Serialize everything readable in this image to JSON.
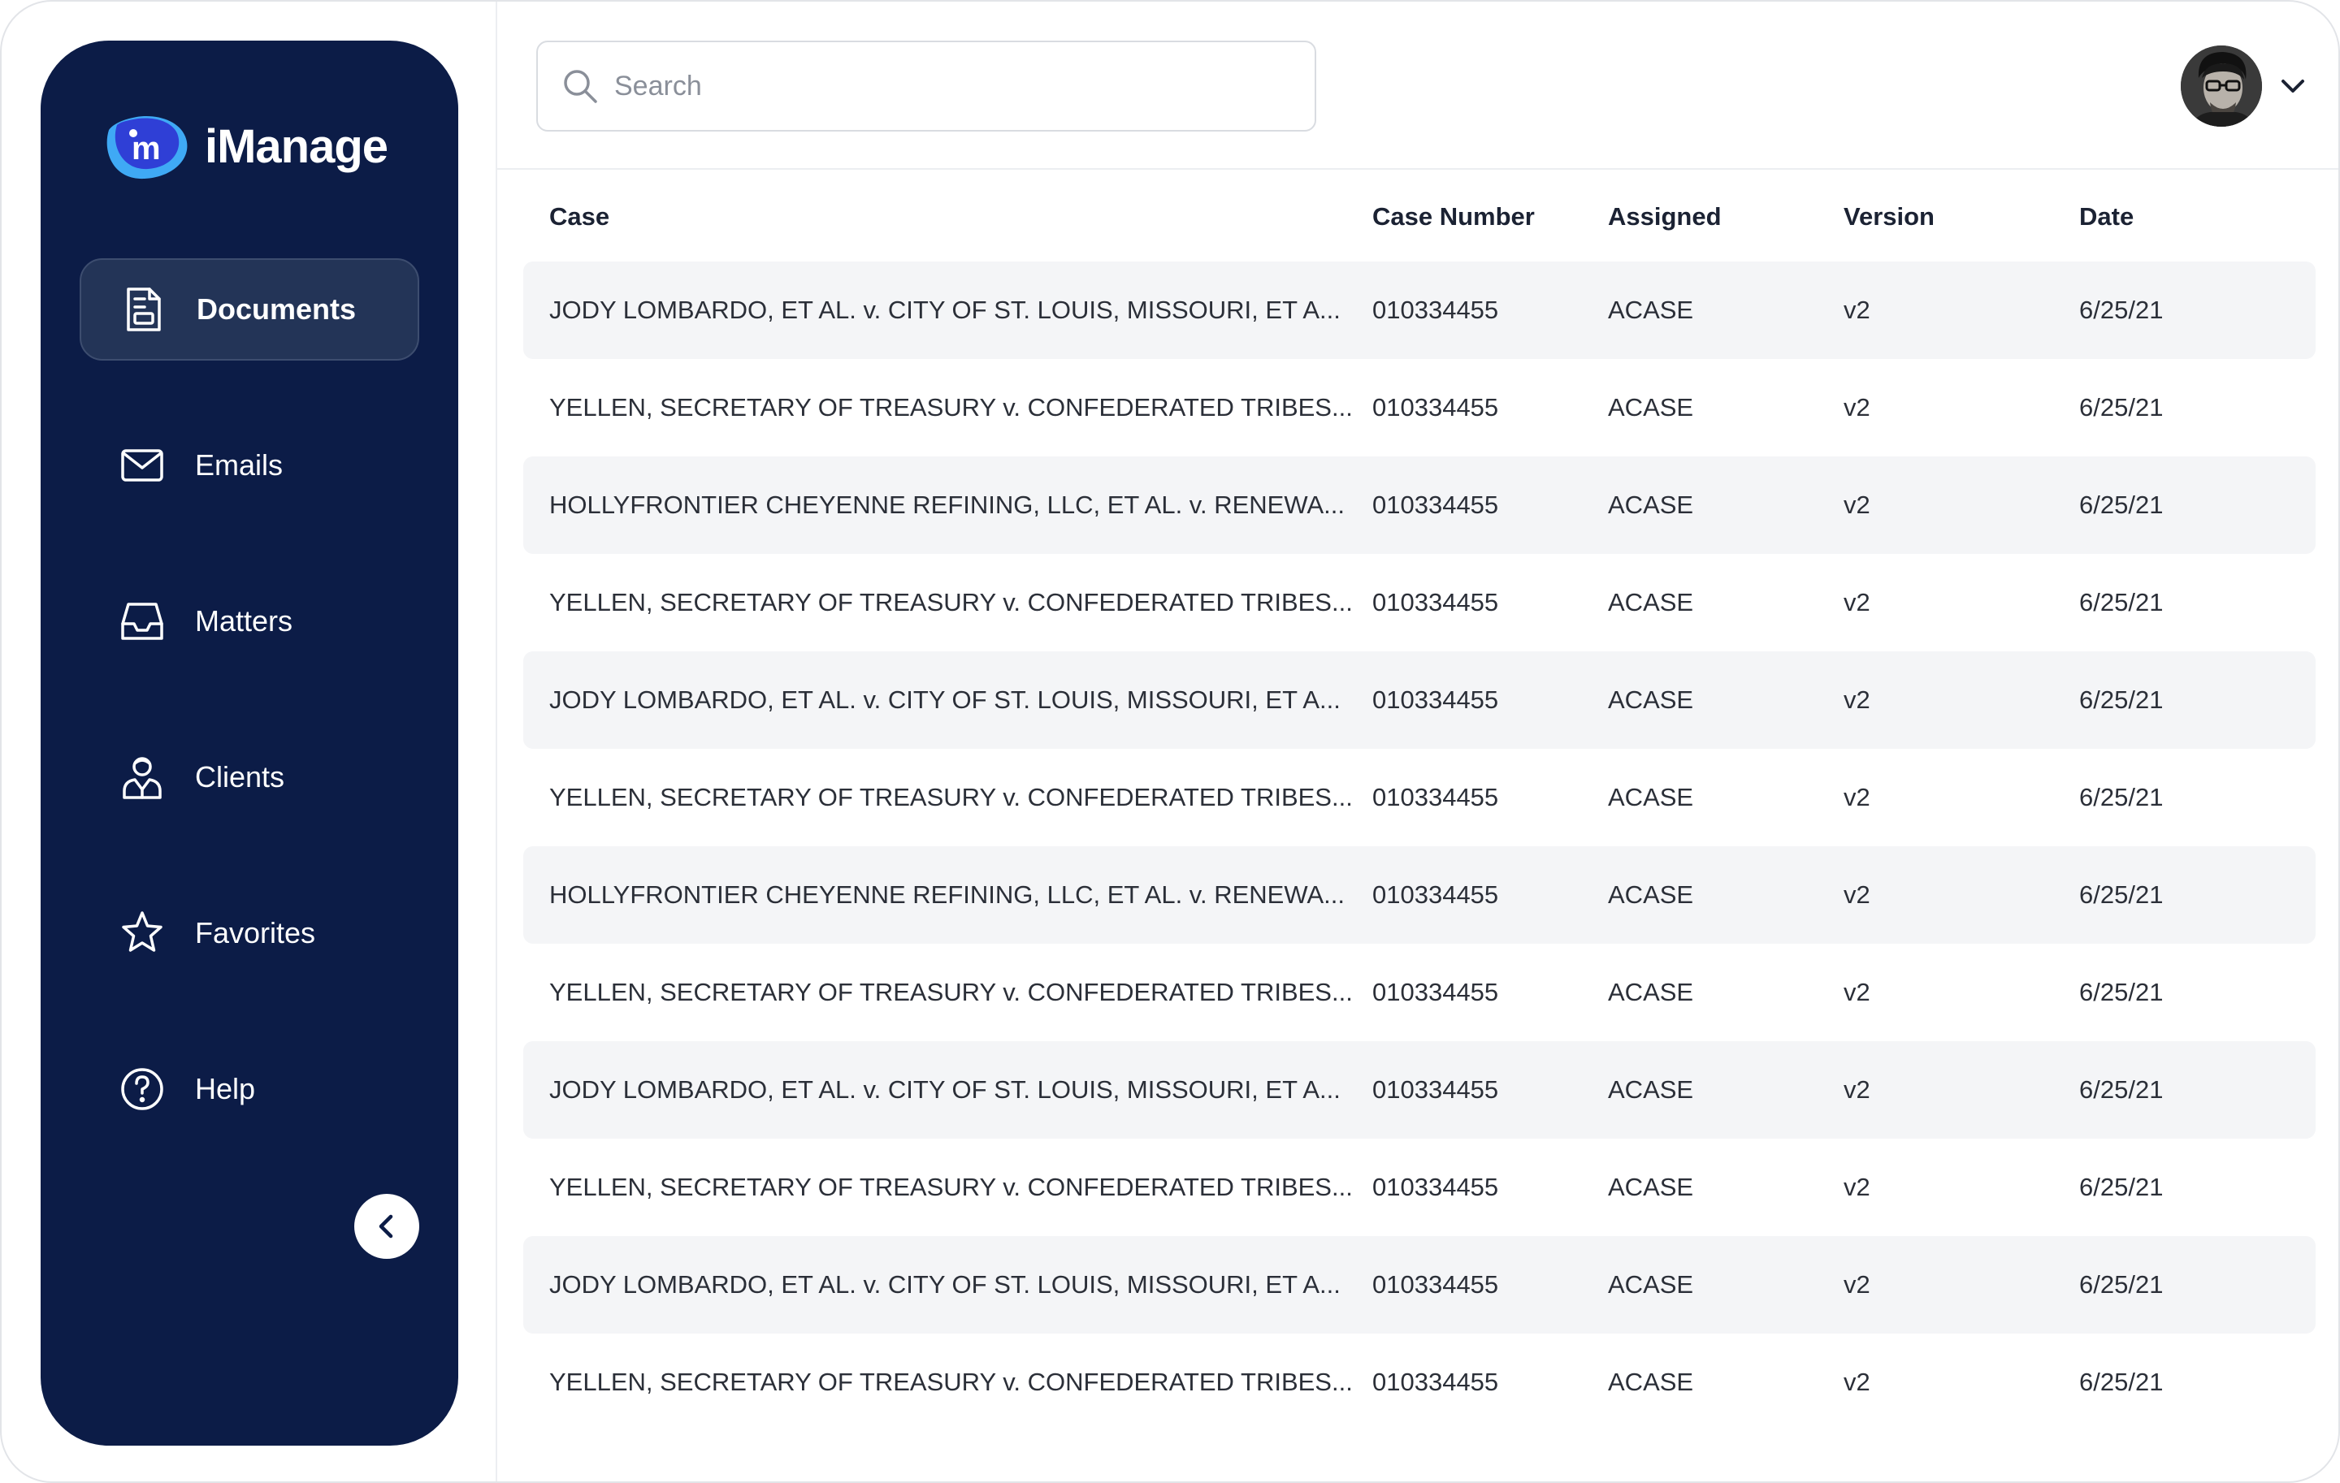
{
  "brand": {
    "name": "iManage",
    "mark_letter": "m",
    "colors": {
      "sidebar": "#0c1c47",
      "mark_light": "#3fa9f5",
      "mark_dark": "#2f3fd6"
    }
  },
  "sidebar": {
    "items": [
      {
        "label": "Documents",
        "icon": "document-icon",
        "active": true
      },
      {
        "label": "Emails",
        "icon": "mail-icon",
        "active": false
      },
      {
        "label": "Matters",
        "icon": "inbox-icon",
        "active": false
      },
      {
        "label": "Clients",
        "icon": "client-icon",
        "active": false
      },
      {
        "label": "Favorites",
        "icon": "star-icon",
        "active": false
      },
      {
        "label": "Help",
        "icon": "help-icon",
        "active": false
      }
    ],
    "collapse_icon": "chevron-left-icon"
  },
  "search": {
    "placeholder": "Search",
    "value": ""
  },
  "user": {
    "avatar_icon": "avatar",
    "menu_icon": "chevron-down-icon"
  },
  "table": {
    "columns": [
      "Case",
      "Case Number",
      "Assigned",
      "Version",
      "Date"
    ],
    "rows": [
      [
        "JODY LOMBARDO, ET AL. v. CITY OF ST. LOUIS, MISSOURI, ET A...",
        "010334455",
        "ACASE",
        "v2",
        "6/25/21"
      ],
      [
        "YELLEN, SECRETARY OF TREASURY v. CONFEDERATED TRIBES...",
        "010334455",
        "ACASE",
        "v2",
        "6/25/21"
      ],
      [
        "HOLLYFRONTIER CHEYENNE REFINING, LLC, ET AL. v. RENEWA...",
        "010334455",
        "ACASE",
        "v2",
        "6/25/21"
      ],
      [
        "YELLEN, SECRETARY OF TREASURY v. CONFEDERATED TRIBES...",
        "010334455",
        "ACASE",
        "v2",
        "6/25/21"
      ],
      [
        "JODY LOMBARDO, ET AL. v. CITY OF ST. LOUIS, MISSOURI, ET A...",
        "010334455",
        "ACASE",
        "v2",
        "6/25/21"
      ],
      [
        "YELLEN, SECRETARY OF TREASURY v. CONFEDERATED TRIBES...",
        "010334455",
        "ACASE",
        "v2",
        "6/25/21"
      ],
      [
        "HOLLYFRONTIER CHEYENNE REFINING, LLC, ET AL. v. RENEWA...",
        "010334455",
        "ACASE",
        "v2",
        "6/25/21"
      ],
      [
        "YELLEN, SECRETARY OF TREASURY v. CONFEDERATED TRIBES...",
        "010334455",
        "ACASE",
        "v2",
        "6/25/21"
      ],
      [
        "JODY LOMBARDO, ET AL. v. CITY OF ST. LOUIS, MISSOURI, ET A...",
        "010334455",
        "ACASE",
        "v2",
        "6/25/21"
      ],
      [
        "YELLEN, SECRETARY OF TREASURY v. CONFEDERATED TRIBES...",
        "010334455",
        "ACASE",
        "v2",
        "6/25/21"
      ],
      [
        "JODY LOMBARDO, ET AL. v. CITY OF ST. LOUIS, MISSOURI, ET A...",
        "010334455",
        "ACASE",
        "v2",
        "6/25/21"
      ],
      [
        "YELLEN, SECRETARY OF TREASURY v. CONFEDERATED TRIBES...",
        "010334455",
        "ACASE",
        "v2",
        "6/25/21"
      ]
    ]
  }
}
